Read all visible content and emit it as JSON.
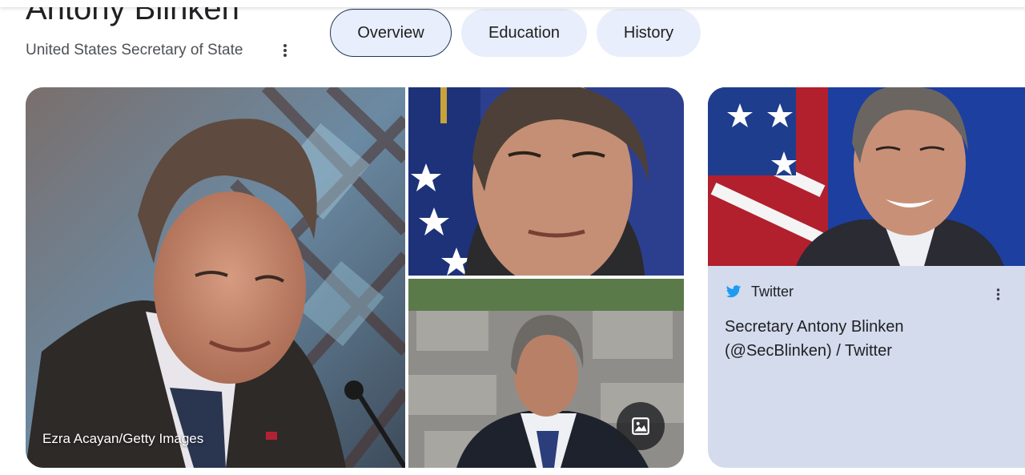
{
  "entity": {
    "name": "Antony Blinken",
    "description": "United States Secretary of State"
  },
  "tabs": [
    {
      "label": "Overview",
      "selected": true
    },
    {
      "label": "Education",
      "selected": false
    },
    {
      "label": "History",
      "selected": false
    }
  ],
  "images": {
    "main_credit": "Ezra Acayan/Getty Images",
    "open_images_icon": "image-icon"
  },
  "twitter_card": {
    "source": "Twitter",
    "title": "Secretary Antony Blinken (@SecBlinken) / Twitter",
    "source_icon": "twitter-bird-icon",
    "menu_icon": "more-vert-icon"
  },
  "colors": {
    "chip_bg": "#e8eefb",
    "chip_border": "#1f3b5a",
    "card_bg": "#d3dbec",
    "twitter_blue": "#1d9bf0"
  }
}
